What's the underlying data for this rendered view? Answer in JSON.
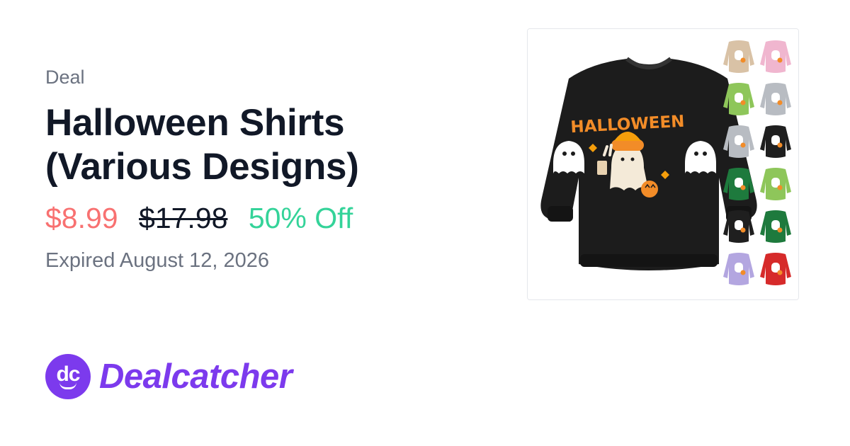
{
  "deal": {
    "label": "Deal",
    "title": "Halloween Shirts (Various Designs)",
    "price": "$8.99",
    "original_price": "$17.98",
    "discount": "50% Off",
    "expiry": "Expired August 12, 2026"
  },
  "product_image": {
    "print_text": "HALLOWEEN",
    "variant_colors": [
      "#d9c2a6",
      "#f0b6cf",
      "#8ec65a",
      "#b8bcc2",
      "#b8bcc2",
      "#1f1f1f",
      "#1e7a3d",
      "#8ec65a",
      "#1f1f1f",
      "#1e7a3d",
      "#b3a6e0",
      "#d62a2a"
    ]
  },
  "brand": {
    "logo_text": "dc",
    "name": "Dealcatcher",
    "color": "#7c3aed"
  },
  "colors": {
    "price": "#f87171",
    "original_price": "#111827",
    "discount": "#34d399",
    "muted": "#6b7280"
  }
}
